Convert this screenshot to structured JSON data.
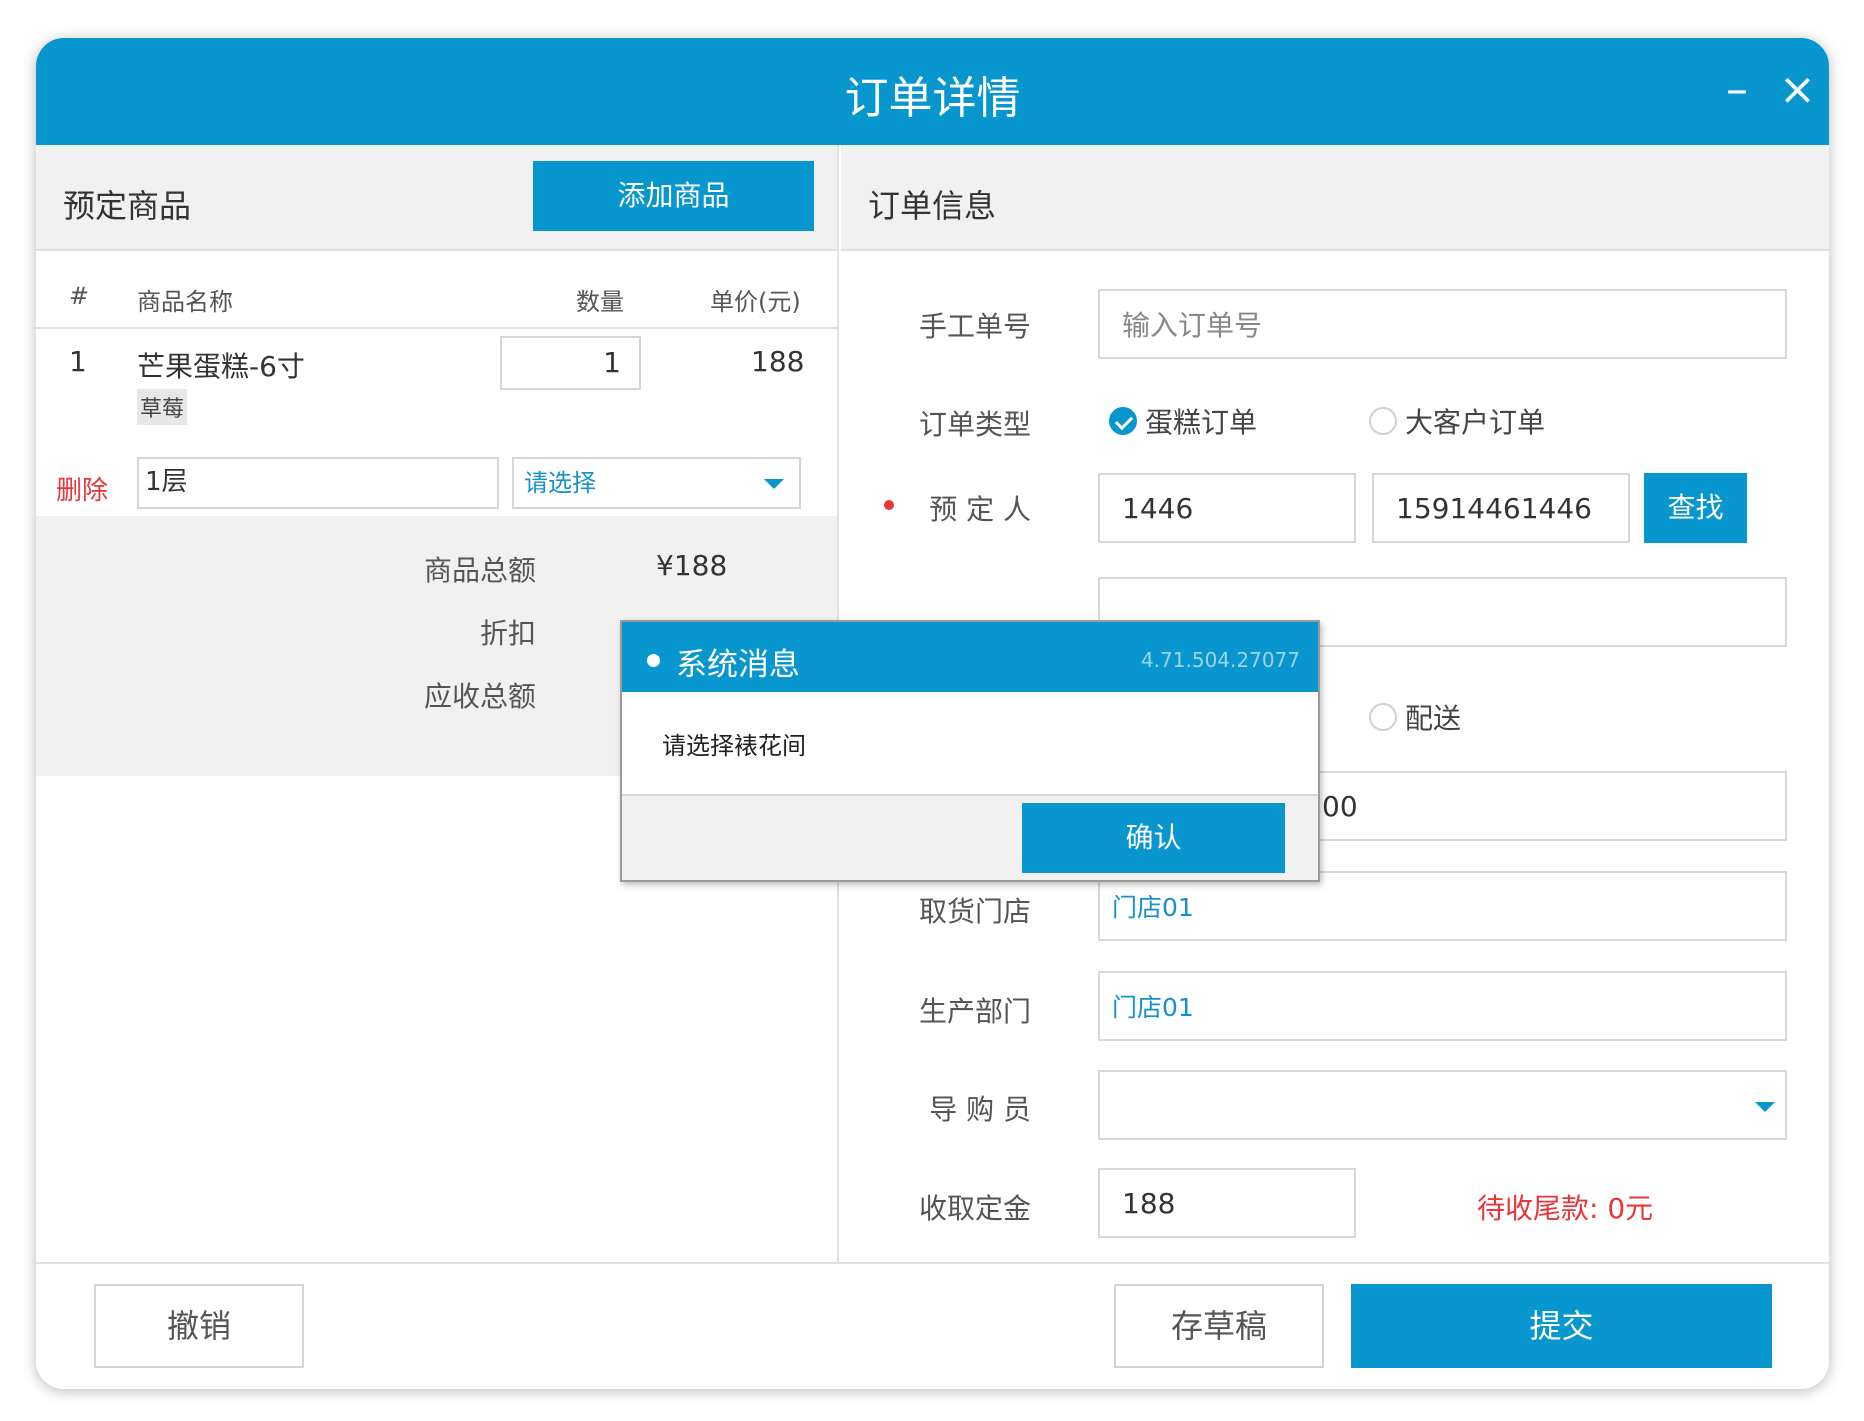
{
  "window": {
    "title": "订单详情",
    "minimize_icon": "–",
    "close_icon": "×"
  },
  "left": {
    "header": "预定商品",
    "add_button": "添加商品",
    "columns": {
      "index": "#",
      "name": "商品名称",
      "qty": "数量",
      "price": "单价(元)"
    },
    "item": {
      "index": "1",
      "name": "芒果蛋糕-6寸",
      "tag": "草莓",
      "qty": "1",
      "price": "188",
      "delete": "删除",
      "layer": "1层",
      "select_placeholder": "请选择"
    },
    "summary": {
      "total_label": "商品总额",
      "total_value": "¥188",
      "discount_label": "折扣",
      "receivable_label": "应收总额"
    }
  },
  "right": {
    "header": "订单信息",
    "manual_no_label": "手工单号",
    "manual_no_placeholder": "输入订单号",
    "order_type_label": "订单类型",
    "order_type_options": [
      "蛋糕订单",
      "大客户订单"
    ],
    "booker_label": "预 定 人",
    "booker_name": "1446",
    "booker_phone": "15914461446",
    "find_button": "查找",
    "delivery_option": "配送",
    "partial_time_value": "00",
    "pickup_store_label": "取货门店",
    "pickup_store_value": "门店01",
    "production_label": "生产部门",
    "production_value": "门店01",
    "guide_label": "导 购 员",
    "deposit_label": "收取定金",
    "deposit_value": "188",
    "balance_text": "待收尾款: 0元"
  },
  "footer": {
    "cancel": "撤销",
    "draft": "存草稿",
    "submit": "提交"
  },
  "dialog": {
    "title": "系统消息",
    "version": "4.71.504.27077",
    "message": "请选择裱花间",
    "confirm": "确认"
  },
  "colors": {
    "primary": "#0796ce",
    "danger": "#e8353a",
    "link": "#1591cf"
  }
}
